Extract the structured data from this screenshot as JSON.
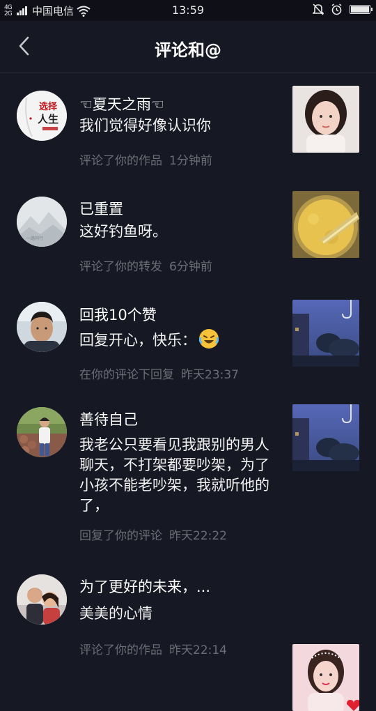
{
  "status_bar": {
    "signal_label": "4G 2G",
    "carrier": "中国电信",
    "time": "13:59"
  },
  "header": {
    "title": "评论和@"
  },
  "notifications": [
    {
      "name": "☜夏天之雨☜",
      "message": "我们觉得好像认识你",
      "action": "评论了你的作品",
      "time": "1分钟前",
      "avatar_icon": "calligraphy-avatar",
      "thumb_icon": "selfie-thumb"
    },
    {
      "name": "已重置",
      "message": "这好钓鱼呀。",
      "action": "评论了你的转发",
      "time": "6分钟前",
      "avatar_icon": "mountain-avatar",
      "thumb_icon": "grain-thumb"
    },
    {
      "name": "回我10个赞",
      "message": "回复开心，快乐：",
      "message_emoji": "laughing-tears-emoji",
      "action": "在你的评论下回复",
      "time": "昨天23:37",
      "avatar_icon": "man-avatar",
      "thumb_icon": "evening-sky-thumb"
    },
    {
      "name": "善待自己",
      "message": "我老公只要看见我跟别的男人聊天，不打架都要吵架，为了小孩不能老吵架，我就听他的了，",
      "action": "回复了你的评论",
      "time": "昨天22:22",
      "avatar_icon": "outdoor-person-avatar",
      "thumb_icon": "evening-sky-thumb"
    },
    {
      "name": "为了更好的未来，...",
      "message": "美美的心情",
      "action": "评论了你的作品",
      "time": "昨天22:14",
      "avatar_icon": "couple-avatar",
      "thumb_icon": "pink-selfie-thumb"
    }
  ]
}
